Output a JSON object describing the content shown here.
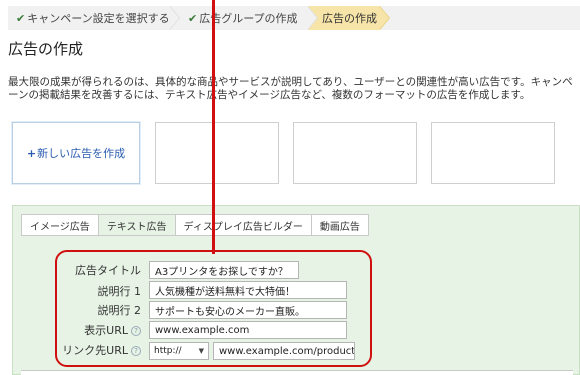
{
  "wizard": {
    "steps": [
      {
        "label": "キャンペーン設定を選択する",
        "done": true
      },
      {
        "label": "広告グループの作成",
        "done": true
      },
      {
        "label": "広告の作成",
        "current": true
      }
    ],
    "check_glyph": "✔"
  },
  "page_title": "広告の作成",
  "description": "最大限の成果が得られるのは、具体的な商品やサービスが説明してあり、ユーザーとの関連性が高い広告です。キャンペーンの掲載結果を改善するには、テキスト広告やイメージ広告など、複数のフォーマットの広告を作成します。",
  "templates": {
    "new_ad_plus": "+",
    "new_ad_label": "新しい広告を作成"
  },
  "tabs": [
    "イメージ広告",
    "テキスト広告",
    "ディスプレイ広告ビルダー",
    "動画広告"
  ],
  "active_tab": "テキスト広告",
  "form": {
    "headline_label": "広告タイトル",
    "headline_value": "A3プリンタをお探しですか？",
    "desc1_label": "説明行 1",
    "desc1_value": "人気機種が送料無料で大特価！",
    "desc2_label": "説明行 2",
    "desc2_value": "サポートも安心のメーカー直販。",
    "display_url_label": "表示URL",
    "display_url_value": "www.example.com",
    "dest_url_label": "リンク先URL",
    "protocol_value": "http://",
    "dest_url_value": "www.example.com/products/pri",
    "help_glyph": "?"
  },
  "colors": {
    "panel_bg": "#e7f3e5",
    "current_step_bg": "#f6e4a8",
    "annotation_red": "#d01010",
    "link_blue": "#2a5db0"
  },
  "icons": [
    "check-icon",
    "plus-icon",
    "help-icon",
    "chevron-down-icon"
  ]
}
